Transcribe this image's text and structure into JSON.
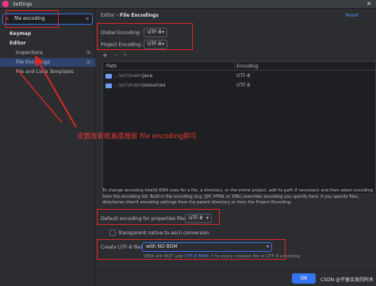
{
  "window": {
    "title": "Settings",
    "close_glyph": "✕"
  },
  "sidebar": {
    "search": {
      "value": "file encoding",
      "icon": "search-icon",
      "clear_glyph": "✕"
    },
    "items": [
      {
        "label": "Keymap"
      },
      {
        "label": "Editor"
      },
      {
        "label": "Inspections",
        "config_glyph": "⊞"
      },
      {
        "label": "File Encodings",
        "config_glyph": "⊞"
      },
      {
        "label": "File and Code Templates"
      }
    ]
  },
  "main": {
    "breadcrumb": {
      "parent": "Editor",
      "separator": "›",
      "current": "File Encodings"
    },
    "reset_label": "Reset",
    "global_encoding": {
      "label": "Global Encoding:",
      "value": "UTF-8"
    },
    "project_encoding": {
      "label": "Project Encoding:",
      "value": "UTF-8"
    },
    "toolbar": {
      "add": "+",
      "remove": "−",
      "edit": "✎"
    },
    "table": {
      "columns": [
        "Path",
        "Encoding"
      ],
      "rows": [
        {
          "path_prefix": "...\\src\\main\\",
          "path_name": "java",
          "encoding": "UTF-8"
        },
        {
          "path_prefix": "...\\src\\main\\",
          "path_name": "resources",
          "encoding": "UTF-8"
        }
      ]
    },
    "note": "To change encoding IntelliJ IDEA uses for a file, a directory, or the entire project, add its path if necessary and then select encoding from the encoding list. Built-in file encoding (e.g. JSP, HTML or XML) overrides encoding you specify here. If you specify files, directories inherit encoding settings from the parent directory or from the Project Encoding.",
    "properties_encoding": {
      "label": "Default encoding for properties files:",
      "value": "UTF-8"
    },
    "transparent_ascii": {
      "label": "Transparent native-to-ascii conversion",
      "checked": false
    },
    "create_bom": {
      "label": "Create UTF-8 files:",
      "value": "with NO BOM"
    },
    "bom_hint": {
      "prefix": "IDEA will NOT add ",
      "link": "UTF-8 BOM ↗",
      "suffix": " to every created file in UTF-8 encoding"
    }
  },
  "footer": {
    "ok_label": "OK",
    "watermark": "CSDN @不留余发的阿木"
  },
  "annotation": {
    "text": "设置搜索框直接搜索 file encoding即可",
    "color": "#e53935"
  },
  "colors": {
    "accent": "#3574f0",
    "annotation_red": "#e02525",
    "folder": "#6f9ef5"
  }
}
